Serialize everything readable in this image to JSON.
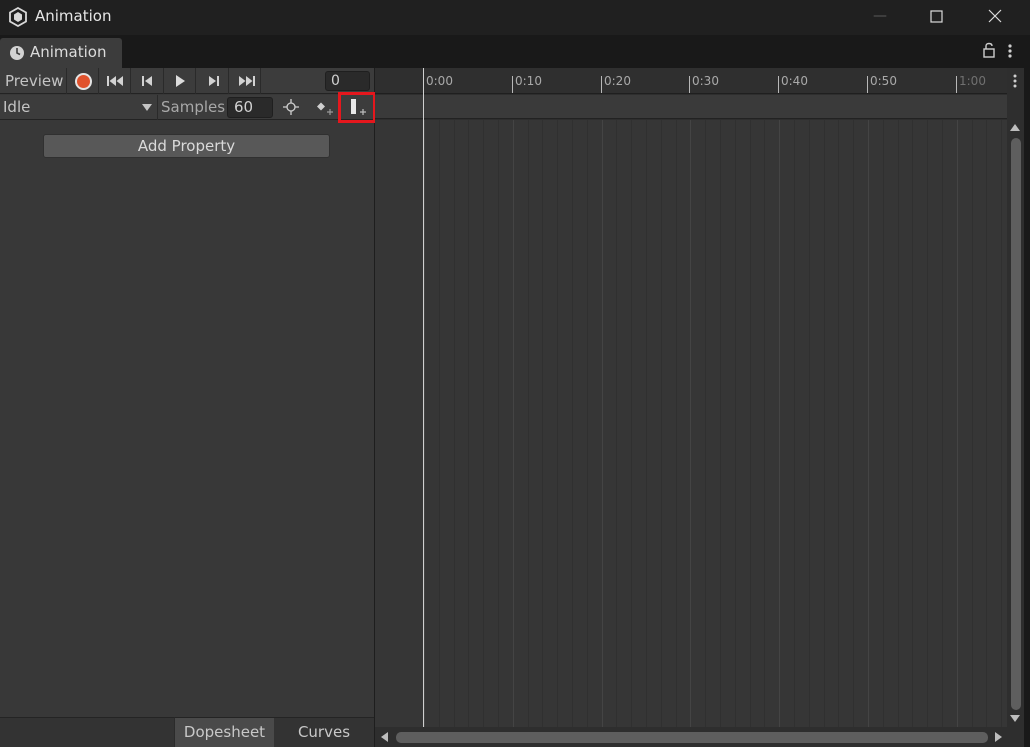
{
  "window": {
    "title": "Animation",
    "controls": {
      "minimize": "—",
      "maximize": "maximize-icon",
      "close": "close-icon"
    }
  },
  "tab": {
    "label": "Animation",
    "icon": "animation-clock-icon"
  },
  "toolbar": {
    "preview_label": "Preview",
    "record_color": "#e0522d",
    "buttons": [
      "record-icon",
      "first-key-icon",
      "previous-key-icon",
      "play-icon",
      "next-key-icon",
      "last-key-icon"
    ],
    "time_value": "0"
  },
  "clip_bar": {
    "clip_name": "Idle",
    "samples_label": "Samples",
    "samples_value": "60",
    "icons": [
      "keyframe-snap-icon",
      "add-keyframe-icon",
      "add-event-icon"
    ],
    "highlight_color": "#e5171d"
  },
  "left_panel": {
    "add_property_label": "Add Property",
    "bottom_tabs": {
      "dopesheet": "Dopesheet",
      "curves": "Curves"
    }
  },
  "timeline": {
    "labels": [
      "0:00",
      "0:10",
      "0:20",
      "0:30",
      "0:40",
      "0:50",
      "1:00"
    ]
  }
}
